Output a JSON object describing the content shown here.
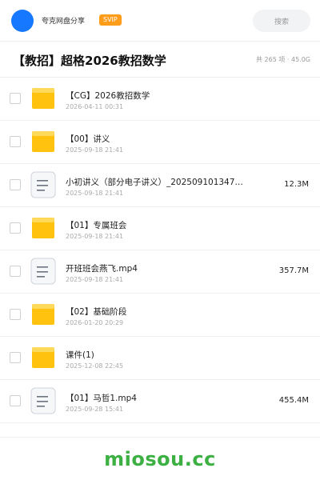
{
  "header": {
    "share_name": "夸克网盘分享",
    "badge": "SVIP",
    "search_placeholder": "搜索",
    "avatar_color": "#1677ff",
    "badge_color": "#ff9c1a"
  },
  "page": {
    "title": "【教招】超格2026教招数学",
    "meta": "共 265 项 · 45.0G"
  },
  "files": [
    {
      "type": "folder",
      "name": "【CG】2026教招数学",
      "date": "2026-04-11 00:31",
      "size": ""
    },
    {
      "type": "folder",
      "name": "【00】讲义",
      "date": "2025-09-18 21:41",
      "size": ""
    },
    {
      "type": "file",
      "name": "小初讲义（部分电子讲义）_20250910134​7…",
      "date": "2025-09-18 21:41",
      "size": "12.3M"
    },
    {
      "type": "folder",
      "name": "【01】专属班会",
      "date": "2025-09-18 21:41",
      "size": ""
    },
    {
      "type": "file",
      "name": "开班班会燕飞.mp4",
      "date": "2025-09-18 21:41",
      "size": "357.7M"
    },
    {
      "type": "folder",
      "name": "【02】基础阶段",
      "date": "2026-01-20 20:29",
      "size": ""
    },
    {
      "type": "folder",
      "name": "课件(1)",
      "date": "2025-12-08 22:45",
      "size": ""
    },
    {
      "type": "file",
      "name": "【01】马哲1.mp4",
      "date": "2025-09-28 15:41",
      "size": "455.4M"
    }
  ],
  "watermark": "miosou.cc",
  "colors": {
    "folder": "#ffc20e",
    "folder_tab": "#ffd95a",
    "watermark": "#3cb043"
  }
}
